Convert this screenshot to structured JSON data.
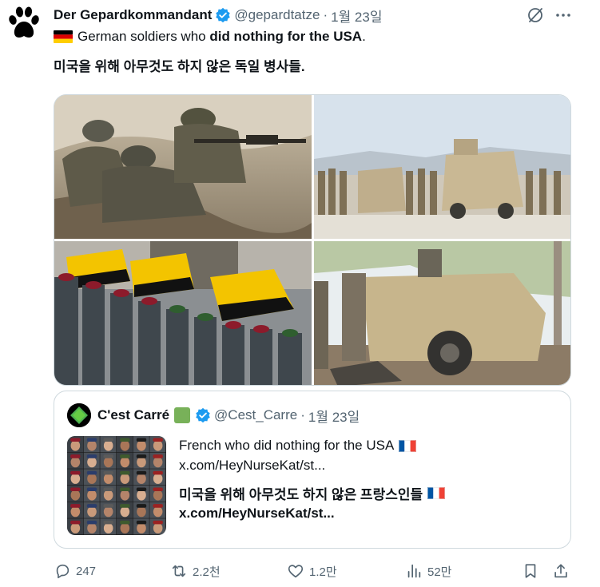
{
  "tweet": {
    "author": {
      "display_name": "Der Gepardkommandant",
      "handle": "@gepardtatze",
      "separator": "·",
      "date": "1월 23일",
      "avatar_icon": "paw-print-icon",
      "verified_color": "#1d9bf0"
    },
    "text_line1_pre": "German soldiers who ",
    "text_line1_bold": "did nothing for the USA",
    "text_line1_post": ".",
    "text_line2": "미국을 위해 아무것도 하지 않은 독일 병사들.",
    "flag_icon": "german-flag-icon",
    "media": [
      {
        "name": "soldiers-machine-gun-photo"
      },
      {
        "name": "soldiers-armored-vehicle-photo"
      },
      {
        "name": "coffins-flags-procession-photo"
      },
      {
        "name": "destroyed-vehicle-photo"
      }
    ]
  },
  "quote": {
    "display_name": "C'est Carré",
    "handle": "@Cest_Carre",
    "separator": "·",
    "date": "1월 23일",
    "line1": "French who did nothing for the USA",
    "line2": "x.com/HeyNurseKat/st...",
    "line3": "미국을 위해 아무것도 하지 않은 프랑스인들",
    "line4": "x.com/HeyNurseKat/st...",
    "flag_icon": "french-flag-icon",
    "thumbnail": "soldier-portraits-grid-image"
  },
  "actions": {
    "replies": "247",
    "reposts": "2.2천",
    "likes": "1.2만",
    "views": "52만"
  },
  "colors": {
    "text": "#0f1419",
    "secondary": "#536471",
    "border": "#cfd9de",
    "accent": "#1d9bf0"
  }
}
